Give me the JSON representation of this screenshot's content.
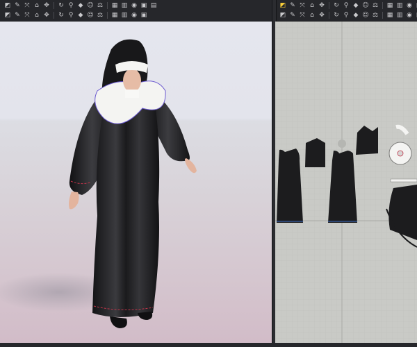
{
  "toolbar_3d": {
    "row1_icons": [
      "select-mesh-icon",
      "edit-pattern-icon",
      "transform-icon",
      "fold-icon",
      "move-icon",
      "rotate-icon",
      "pin-icon",
      "tack-icon",
      "avatar-icon",
      "measure-icon",
      "fabric-icon",
      "texture-icon",
      "render-icon",
      "camera-icon",
      "grid-icon"
    ],
    "row2_icons": [
      "arrangement-icon",
      "strap-icon",
      "fold-arrange-icon",
      "pin-box-icon",
      "layer-icon",
      "measure-tape-icon",
      "tape-icon",
      "button-icon",
      "seam-icon",
      "trim-icon",
      "sync-icon",
      "zoom-icon",
      "ruler-icon",
      "dot-icon"
    ]
  },
  "toolbar_2d": {
    "row1_icons": [
      "transform-pattern-icon",
      "edit-curve-icon",
      "add-point-icon",
      "polygon-icon",
      "rectangle-icon",
      "circle-icon",
      "internal-line-icon",
      "dart-icon",
      "trace-icon",
      "notch-icon",
      "text-icon",
      "image-icon",
      "copy-icon",
      "grid-pattern-icon",
      "stack-icon"
    ],
    "row2_icons": [
      "segment-sewing-icon",
      "free-sewing-icon",
      "edit-sewing-icon",
      "fold-line-icon",
      "elastic-icon",
      "pleat-icon",
      "button-2d-icon",
      "buttonhole-icon",
      "graphic-icon",
      "measure-2d-icon",
      "topstitch-icon",
      "puckering-icon",
      "pin-2d-icon",
      "dropdown-icon"
    ]
  },
  "colors": {
    "garment": "#1c1c1e",
    "collar": "#f4f4f2",
    "seam_red": "#c0344a",
    "seam_blue": "#3e6fc8",
    "grid_bg": "#c9cac6",
    "accent": "#ffd33a"
  }
}
